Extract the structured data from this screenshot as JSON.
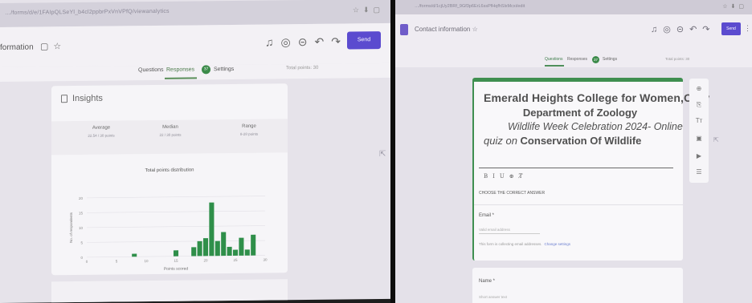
{
  "left": {
    "url": "…/forms/d/e/1FAIpQLSeYl_b4cl2ppbrPxVnVPfQ/viewanalytics",
    "browser_icons": [
      "☆",
      "⬇",
      "▢"
    ],
    "form_title_partial": "formation",
    "toolbar_icons": [
      "palette",
      "eye",
      "link",
      "undo",
      "redo"
    ],
    "send_label": "Send",
    "tabs": [
      {
        "label": "Questions",
        "active": false
      },
      {
        "label": "Responses",
        "active": true
      },
      {
        "label": "Settings",
        "active": false
      }
    ],
    "responses_count": "37",
    "total_points": "Total points: 30",
    "insights_label": "Insights",
    "stats": [
      {
        "label": "Average",
        "value": "22.54 / 30 points"
      },
      {
        "label": "Median",
        "value": "22 / 30 points"
      },
      {
        "label": "Range",
        "value": "8-28 points"
      }
    ],
    "chart_data": {
      "type": "bar",
      "title": "Total points distribution",
      "xlabel": "Points scored",
      "ylabel": "No. of respondents",
      "xlim": [
        0,
        30
      ],
      "ylim": [
        0,
        20
      ],
      "xticks": [
        0,
        5,
        10,
        15,
        20,
        25,
        30
      ],
      "yticks": [
        0,
        5,
        10,
        15,
        20
      ],
      "x": [
        8,
        15,
        18,
        19,
        20,
        21,
        22,
        23,
        24,
        25,
        26,
        27,
        28
      ],
      "values": [
        1,
        2,
        3,
        5,
        6,
        18,
        5,
        8,
        3,
        2,
        6,
        2,
        7
      ],
      "bar_color": "#2f8f4a"
    }
  },
  "right": {
    "url": "…/forms/d/1cjUy2BRf_9Gf3p6ErL6ssPfHqfhSlxMcxi/edit",
    "browser_icons": [
      "☆",
      "⬇",
      "▢"
    ],
    "form_title": "Contact information",
    "toolbar_icons": [
      "palette",
      "eye",
      "link",
      "undo",
      "redo"
    ],
    "send_label": "Send",
    "tabs": [
      {
        "label": "Questions",
        "active": true
      },
      {
        "label": "Responses",
        "active": false
      },
      {
        "label": "Settings",
        "active": false
      }
    ],
    "responses_count": "37",
    "total_points": "Total points: 30",
    "heading": {
      "line1a": "Emerald Heights ",
      "line1b": "College for Women,Ooty",
      "line2": "Department of Zoology",
      "line3": "Wildlife Week Celebration  2024- Online",
      "line4a": "quiz on ",
      "line4b": "Conservation  Of  Wildlife"
    },
    "format_tools": [
      "B",
      "I",
      "U",
      "⊕",
      "T̸"
    ],
    "description": "CHOOSE THE CORRECT ANSWER",
    "email_label": "Email *",
    "email_placeholder": "Valid email address",
    "collect_note": "This form is collecting email addresses.",
    "collect_link": "Change settings",
    "side_tools": [
      "⊕",
      "⎘",
      "Tт",
      "▣",
      "▶",
      "☰"
    ],
    "name_label": "Name *",
    "name_placeholder": "Short answer text"
  }
}
